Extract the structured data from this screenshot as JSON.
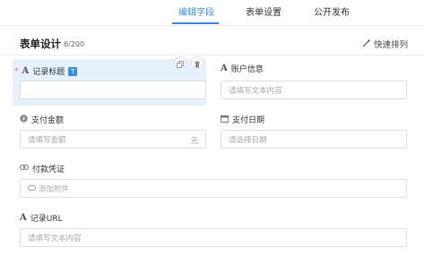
{
  "tabs": [
    {
      "label": "编辑字段",
      "active": true
    },
    {
      "label": "表单设置",
      "active": false
    },
    {
      "label": "公开发布",
      "active": false
    }
  ],
  "header": {
    "title": "表单设计",
    "count": "6/200",
    "quick_sort_label": "快速排列"
  },
  "fields": [
    {
      "label": "记录标题",
      "icon": "text-icon",
      "required": true,
      "type_badge": "T",
      "placeholder": "",
      "selected": true
    },
    {
      "label": "账户信息",
      "icon": "text-icon",
      "placeholder": "请填写文本内容"
    },
    {
      "label": "支付金额",
      "icon": "currency-icon",
      "placeholder": "请填写金额",
      "suffix": "元"
    },
    {
      "label": "支付日期",
      "icon": "calendar-icon",
      "placeholder": "请选择日期"
    },
    {
      "label": "付款凭证",
      "icon": "link-icon",
      "placeholder": "添加附件",
      "placeholder_icon": "attachment-icon"
    },
    {
      "label": "记录URL",
      "icon": "text-icon",
      "placeholder": "请填写文本内容"
    }
  ],
  "colors": {
    "accent": "#3a8ee6",
    "selected_bg": "#e6f1fc",
    "required": "#f56c6c"
  }
}
